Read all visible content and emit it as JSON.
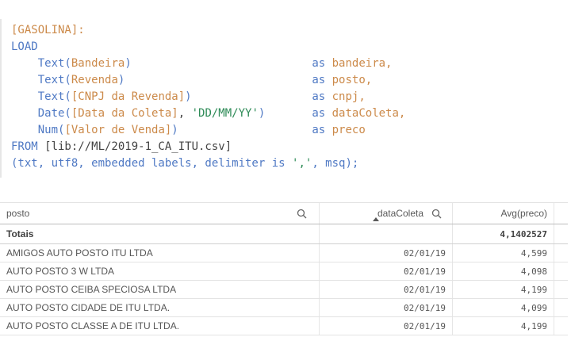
{
  "editor": {
    "lines": [
      [
        {
          "t": "[GASOLINA]:",
          "c": "ident"
        }
      ],
      [
        {
          "t": "LOAD",
          "c": "kw"
        }
      ],
      [
        {
          "t": "    ",
          "c": "plain"
        },
        {
          "t": "Text(",
          "c": "kw"
        },
        {
          "t": "Bandeira",
          "c": "ident"
        },
        {
          "t": ")",
          "c": "kw"
        },
        {
          "t": "                           ",
          "c": "plain"
        },
        {
          "t": "as",
          "c": "kw"
        },
        {
          "t": " bandeira,",
          "c": "ident"
        }
      ],
      [
        {
          "t": "    ",
          "c": "plain"
        },
        {
          "t": "Text(",
          "c": "kw"
        },
        {
          "t": "Revenda",
          "c": "ident"
        },
        {
          "t": ")",
          "c": "kw"
        },
        {
          "t": "                            ",
          "c": "plain"
        },
        {
          "t": "as",
          "c": "kw"
        },
        {
          "t": " posto,",
          "c": "ident"
        }
      ],
      [
        {
          "t": "    ",
          "c": "plain"
        },
        {
          "t": "Text(",
          "c": "kw"
        },
        {
          "t": "[CNPJ da Revenda]",
          "c": "ident"
        },
        {
          "t": ")",
          "c": "kw"
        },
        {
          "t": "                  ",
          "c": "plain"
        },
        {
          "t": "as",
          "c": "kw"
        },
        {
          "t": " cnpj,",
          "c": "ident"
        }
      ],
      [
        {
          "t": "    ",
          "c": "plain"
        },
        {
          "t": "Date(",
          "c": "kw"
        },
        {
          "t": "[Data da Coleta]",
          "c": "ident"
        },
        {
          "t": ", ",
          "c": "plain"
        },
        {
          "t": "'DD/MM/YY'",
          "c": "str"
        },
        {
          "t": ")",
          "c": "kw"
        },
        {
          "t": "       ",
          "c": "plain"
        },
        {
          "t": "as",
          "c": "kw"
        },
        {
          "t": " dataColeta,",
          "c": "ident"
        }
      ],
      [
        {
          "t": "    ",
          "c": "plain"
        },
        {
          "t": "Num(",
          "c": "kw"
        },
        {
          "t": "[Valor de Venda]",
          "c": "ident"
        },
        {
          "t": ")",
          "c": "kw"
        },
        {
          "t": "                    ",
          "c": "plain"
        },
        {
          "t": "as",
          "c": "kw"
        },
        {
          "t": " preco",
          "c": "ident"
        }
      ],
      [
        {
          "t": "FROM",
          "c": "kw"
        },
        {
          "t": " [lib://ML/2019-1_CA_ITU.csv]",
          "c": "plain"
        }
      ],
      [
        {
          "t": "(txt, utf8, embedded labels, delimiter is ",
          "c": "kw"
        },
        {
          "t": "','",
          "c": "str"
        },
        {
          "t": ", msq);",
          "c": "kw"
        }
      ]
    ]
  },
  "table": {
    "columns": [
      "posto",
      "dataColeta",
      "Avg(preco)"
    ],
    "totals": {
      "label": "Totais",
      "avg": "4,1402527"
    },
    "rows": [
      {
        "posto": "AMIGOS AUTO POSTO ITU LTDA",
        "data": "02/01/19",
        "avg": "4,599"
      },
      {
        "posto": "AUTO POSTO 3 W LTDA",
        "data": "02/01/19",
        "avg": "4,098"
      },
      {
        "posto": "AUTO POSTO CEIBA SPECIOSA LTDA",
        "data": "02/01/19",
        "avg": "4,199"
      },
      {
        "posto": "AUTO POSTO CIDADE DE ITU LTDA.",
        "data": "02/01/19",
        "avg": "4,099"
      },
      {
        "posto": "AUTO POSTO CLASSE A DE ITU LTDA.",
        "data": "02/01/19",
        "avg": "4,199"
      }
    ]
  }
}
